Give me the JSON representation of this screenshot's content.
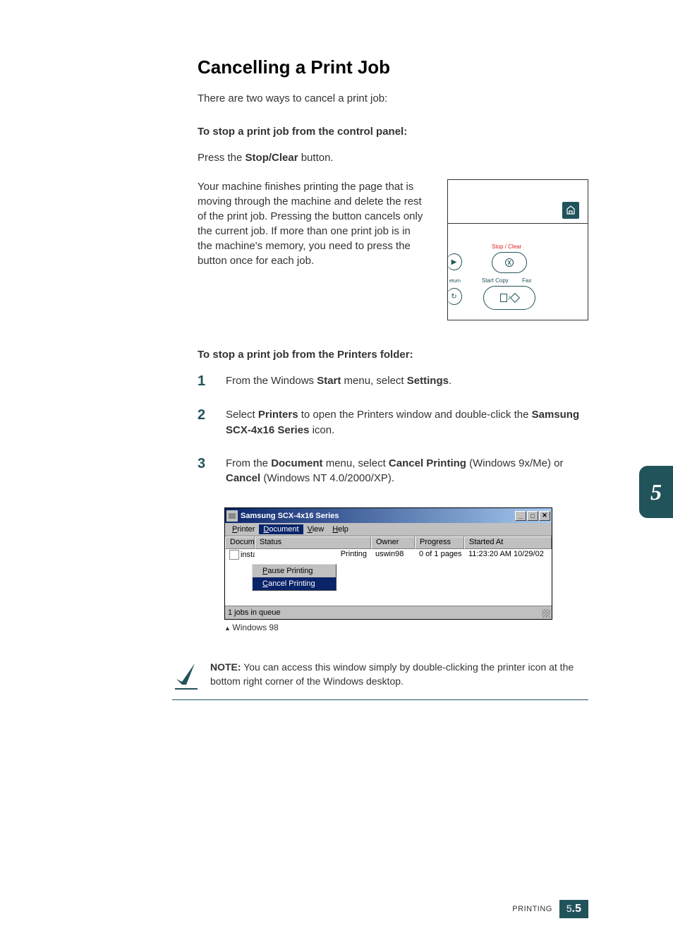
{
  "heading": "Cancelling a Print Job",
  "intro": "There are two ways to cancel a print job:",
  "sub1": "To stop a print job from the control panel:",
  "pressText_pre": "Press the ",
  "pressText_bold": "Stop/Clear",
  "pressText_post": " button.",
  "panelText": "Your machine finishes printing the page that is moving through the machine and delete the rest of the print job. Pressing the button cancels only the current job. If more than one print job is in the machine's memory, you need to press the button once for each job.",
  "panel": {
    "stopClear": "Stop / Clear",
    "startCopy": "Start Copy",
    "fax": "Fax",
    "return": "eturn"
  },
  "sub2": "To stop a print job from the Printers folder:",
  "steps": [
    {
      "num": "1",
      "parts": [
        "From the Windows ",
        "Start",
        " menu, select ",
        "Settings",
        "."
      ]
    },
    {
      "num": "2",
      "parts": [
        "Select ",
        "Printers",
        " to open the Printers window and double-click the ",
        "Samsung SCX-4x16 Series",
        " icon."
      ]
    },
    {
      "num": "3",
      "parts": [
        "From the ",
        "Document",
        " menu, select ",
        "Cancel Printing",
        " (Windows 9x/Me) or ",
        "Cancel",
        " (Windows NT 4.0/2000/XP)."
      ]
    }
  ],
  "window": {
    "title": "Samsung SCX-4x16 Series",
    "menus": [
      "Printer",
      "Document",
      "View",
      "Help"
    ],
    "dropdown": [
      "Pause Printing",
      "Cancel Printing"
    ],
    "headers": [
      "Docum",
      "Status",
      "Owner",
      "Progress",
      "Started At"
    ],
    "row": [
      "insta",
      "Printing",
      "uswin98",
      "0 of 1 pages",
      "11:23:20 AM 10/29/02"
    ],
    "status": "1 jobs in queue"
  },
  "caption": "Windows 98",
  "note": {
    "label": "NOTE:",
    "text": " You can access this window simply by double-clicking the printer icon at the bottom right corner of the Windows desktop."
  },
  "tabNumber": "5",
  "footer": {
    "label": "PRINTING",
    "pageMajor": "5",
    "pageMinor": ".5"
  }
}
